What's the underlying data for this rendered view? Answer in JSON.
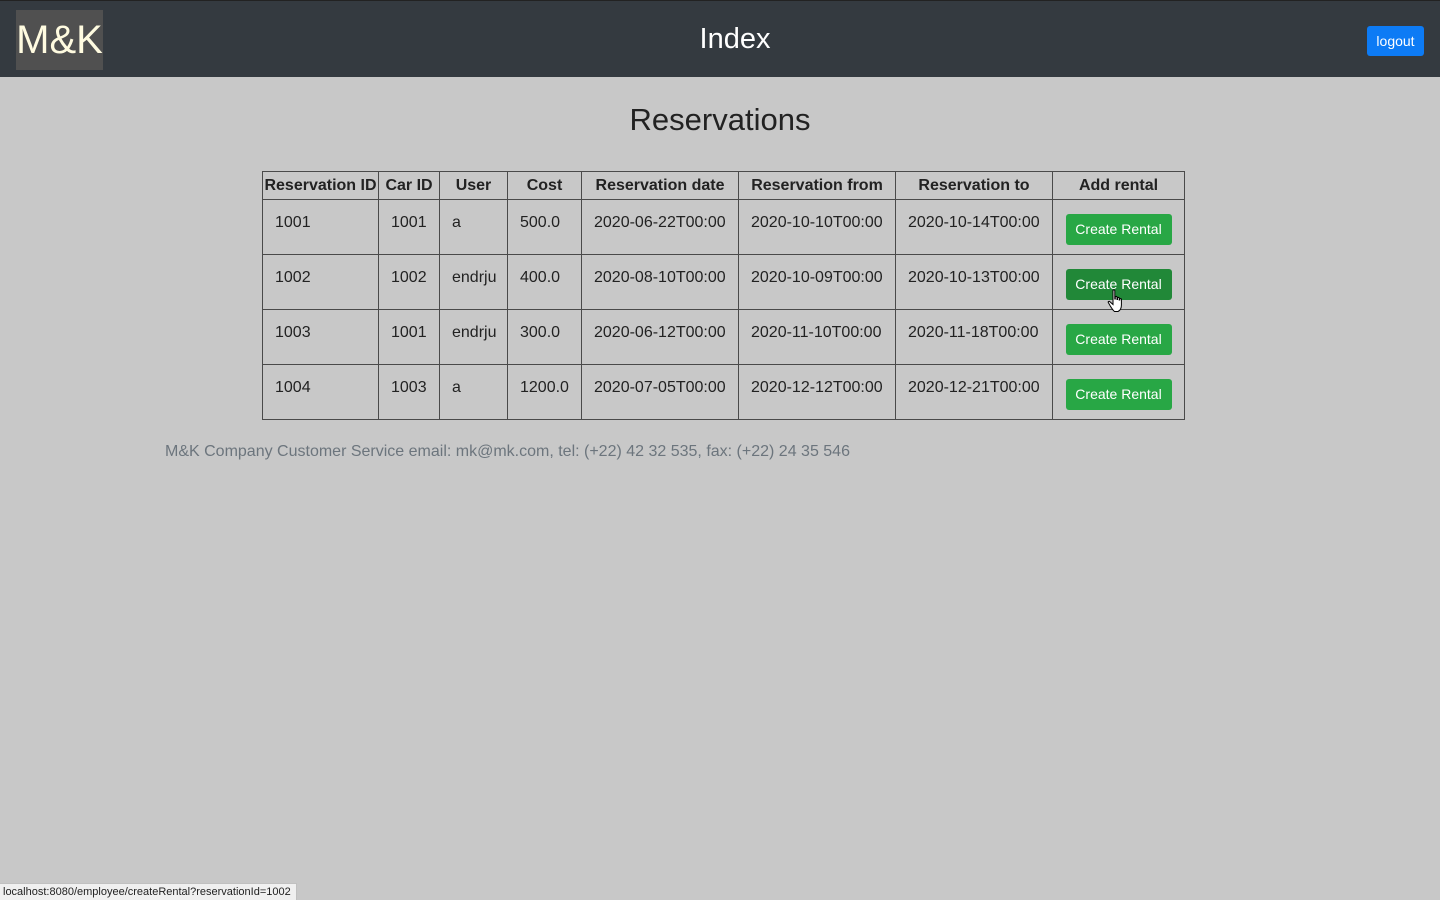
{
  "header": {
    "logo_text": "M&K",
    "title": "Index",
    "logout_label": "logout"
  },
  "main": {
    "heading": "Reservations",
    "table": {
      "columns": [
        "Reservation ID",
        "Car ID",
        "User",
        "Cost",
        "Reservation date",
        "Reservation from",
        "Reservation to",
        "Add rental"
      ],
      "rows": [
        {
          "reservation_id": "1001",
          "car_id": "1001",
          "user": "a",
          "cost": "500.0",
          "reservation_date": "2020-06-22T00:00",
          "reservation_from": "2020-10-10T00:00",
          "reservation_to": "2020-10-14T00:00",
          "action_label": "Create Rental"
        },
        {
          "reservation_id": "1002",
          "car_id": "1002",
          "user": "endrju",
          "cost": "400.0",
          "reservation_date": "2020-08-10T00:00",
          "reservation_from": "2020-10-09T00:00",
          "reservation_to": "2020-10-13T00:00",
          "action_label": "Create Rental"
        },
        {
          "reservation_id": "1003",
          "car_id": "1001",
          "user": "endrju",
          "cost": "300.0",
          "reservation_date": "2020-06-12T00:00",
          "reservation_from": "2020-11-10T00:00",
          "reservation_to": "2020-11-18T00:00",
          "action_label": "Create Rental"
        },
        {
          "reservation_id": "1004",
          "car_id": "1003",
          "user": "a",
          "cost": "1200.0",
          "reservation_date": "2020-07-05T00:00",
          "reservation_from": "2020-12-12T00:00",
          "reservation_to": "2020-12-21T00:00",
          "action_label": "Create Rental"
        }
      ]
    }
  },
  "footer": {
    "text": "M&K Company Customer Service email: mk@mk.com, tel: (+22) 42 32 535, fax: (+22) 24 35 546"
  },
  "status_bar": {
    "url": "localhost:8080/employee/createRental?reservationId=1002"
  },
  "colors": {
    "page_background": "#c8c8c8",
    "topbar_background": "#343a40",
    "logout_button": "#0d7bf5",
    "create_button": "#28a745",
    "create_button_hover": "#218838",
    "footer_text": "#6c757d"
  }
}
